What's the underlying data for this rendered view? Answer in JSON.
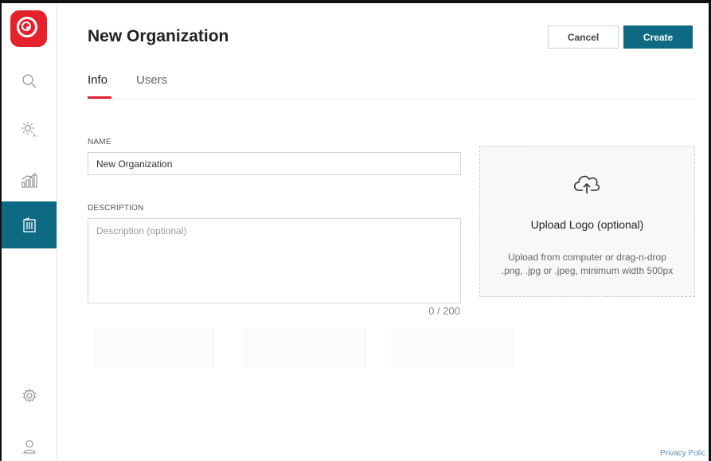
{
  "header": {
    "title": "New Organization",
    "cancel_label": "Cancel",
    "create_label": "Create"
  },
  "tabs": [
    {
      "label": "Info",
      "active": true
    },
    {
      "label": "Users",
      "active": false
    }
  ],
  "form": {
    "name_label": "NAME",
    "name_value": "New Organization",
    "description_label": "DESCRIPTION",
    "description_placeholder": "Description (optional)",
    "description_counter": "0 / 200"
  },
  "upload": {
    "title": "Upload Logo (optional)",
    "hint_line1": "Upload from computer or drag-n-drop",
    "hint_line2": ".png, .jpg or .jpeg, minimum width 500px",
    "icon": "cloud-upload-icon"
  },
  "sidebar": {
    "items": [
      {
        "name": "search",
        "icon": "search-icon"
      },
      {
        "name": "ai-insights",
        "icon": "sun-ai-icon"
      },
      {
        "name": "analytics",
        "icon": "bar-chart-icon"
      },
      {
        "name": "organizations",
        "icon": "building-icon",
        "active": true
      },
      {
        "name": "settings",
        "icon": "gear-icon"
      },
      {
        "name": "account",
        "icon": "user-icon"
      }
    ]
  },
  "footer": {
    "privacy_label": "Privacy Polic"
  },
  "colors": {
    "accent": "#0e6a82",
    "brand": "#e4222b"
  }
}
